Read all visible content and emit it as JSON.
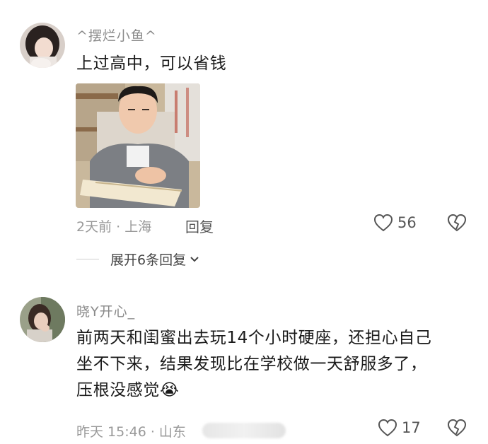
{
  "comments": [
    {
      "username": "^摆烂小鱼^",
      "text": "上过高中，可以省钱",
      "meta": "2天前 · 上海",
      "reply_label": "回复",
      "likes": "56",
      "expand_label": "展开6条回复"
    },
    {
      "username": "晓Y开心_",
      "text_line1": "前两天和闺蜜出去玩14个小时硬座，还担心自己",
      "text_line2": "坐不下来，结果发现比在学校做一天舒服多了，",
      "text_line3": "压根没感觉",
      "emoji": "😭",
      "meta": "昨天 15:46 · 山东",
      "likes": "17"
    }
  ],
  "icons": {
    "like": "heart-outline-icon",
    "dislike": "broken-heart-icon",
    "expand": "chevron-down-icon",
    "emoji": "crying-face-icon"
  }
}
